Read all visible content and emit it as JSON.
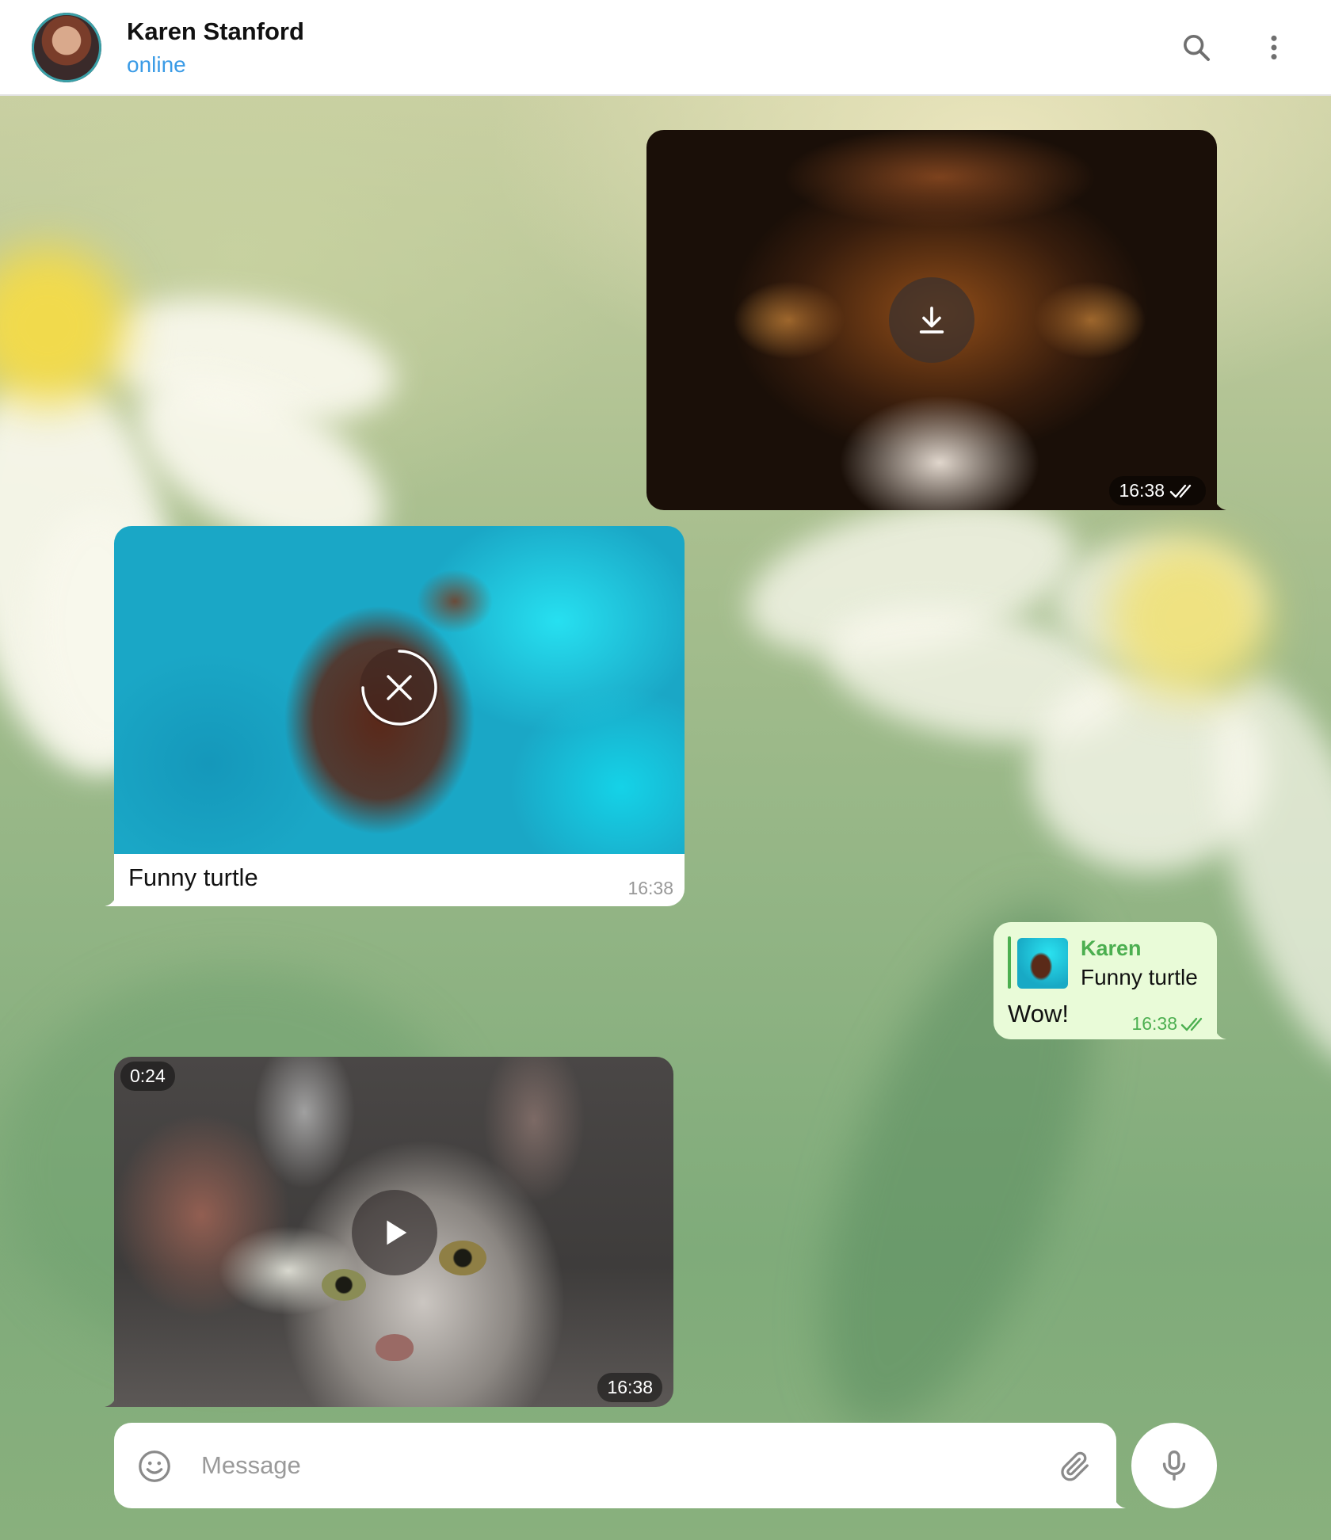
{
  "header": {
    "name": "Karen Stanford",
    "status": "online",
    "status_color": "#3a9be6"
  },
  "messages": [
    {
      "id": "m1",
      "direction": "outgoing",
      "kind": "photo",
      "state": "download",
      "time": "16:38",
      "read": true
    },
    {
      "id": "m2",
      "direction": "incoming",
      "kind": "photo",
      "state": "loading-cancel",
      "caption": "Funny turtle",
      "time": "16:38"
    },
    {
      "id": "m3",
      "direction": "outgoing",
      "kind": "text",
      "reply": {
        "author": "Karen",
        "text": "Funny turtle"
      },
      "text": "Wow!",
      "time": "16:38",
      "read": true
    },
    {
      "id": "m4",
      "direction": "incoming",
      "kind": "video",
      "duration": "0:24",
      "time": "16:38"
    }
  ],
  "composer": {
    "placeholder": "Message",
    "icons": [
      "emoji-icon",
      "paperclip-icon",
      "microphone-icon"
    ]
  },
  "colors": {
    "outgoing_bubble": "#e9fbd8",
    "incoming_bubble": "#ffffff",
    "accent_green": "#4caf50",
    "check_color": "#4caf50"
  }
}
